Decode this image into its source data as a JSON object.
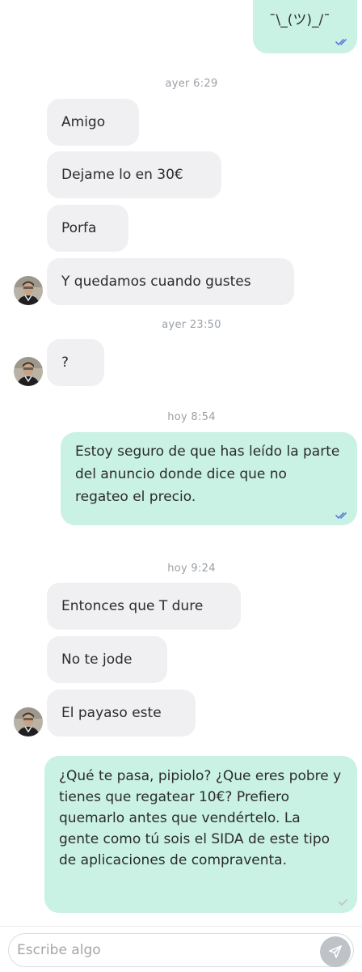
{
  "messages": {
    "m1": "¯\\_(ツ)_/¯",
    "m2": "Amigo",
    "m3": "Dejame lo en 30€",
    "m4": "Porfa",
    "m5": "Y quedamos cuando gustes",
    "m6": "?",
    "m7": "Estoy seguro de que has leído la parte del anuncio donde dice que no regateo el precio.",
    "m8": "Entonces que T dure",
    "m9": "No te jode",
    "m10": "El payaso este",
    "m11": "¿Qué te pasa, pipiolo? ¿Que eres pobre y tienes que regatear 10€? Prefiero quemarlo antes que vendértelo. La gente como tú sois el SIDA de este tipo de aplicaciones de compraventa."
  },
  "timestamps": {
    "t1": "ayer 6:29",
    "t2": "ayer 23:50",
    "t3": "hoy 8:54",
    "t4": "hoy 9:24"
  },
  "composer": {
    "placeholder": "Escribe algo"
  },
  "colors": {
    "outgoing_bubble": "#c9f2e4",
    "incoming_bubble": "#f0f0f2",
    "read_tick": "#5b7fd6",
    "sent_tick": "#c2c2c2",
    "send_button": "#bfc3c7"
  },
  "icons": {
    "read": "double-check-icon",
    "sent": "single-check-icon",
    "send": "paper-plane-icon"
  }
}
